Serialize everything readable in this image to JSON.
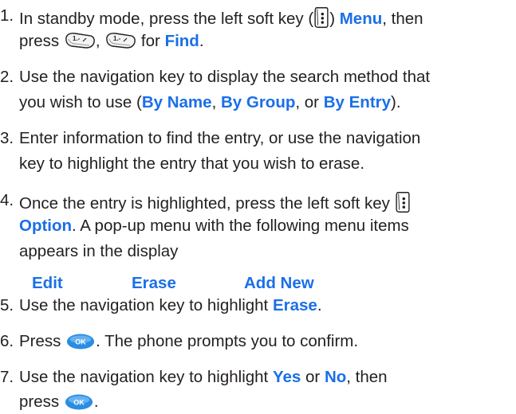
{
  "steps": [
    {
      "num": "1.",
      "l1a": "In standby mode, press the left soft key (",
      "l1b": ") ",
      "l1c": "Menu",
      "l1d": ", then",
      "l2a": "press ",
      "l2b": ", ",
      "l2c": " for ",
      "l2d": "Find",
      "l2e": "."
    },
    {
      "num": "2.",
      "l1": "Use the navigation key to display the search method that",
      "l2a": "you wish to use (",
      "l2b": "By Name",
      "l2c": ", ",
      "l2d": "By Group",
      "l2e": ", or ",
      "l2f": "By Entry",
      "l2g": ")."
    },
    {
      "num": "3.",
      "l1": "Enter information to find the entry, or use the navigation",
      "l2": "key to highlight the entry that you wish to erase."
    },
    {
      "num": "4.",
      "l1": "Once the entry is highlighted, press the left soft key",
      "l2a": "Option",
      "l2b": ". A pop-up menu with the following menu items",
      "l3": "appears in the display"
    },
    {
      "num": "5.",
      "l1a": "Use the navigation key to highlight ",
      "l1b": "Erase",
      "l1c": "."
    },
    {
      "num": "6.",
      "l1a": "Press ",
      "l1b": ". The phone prompts you to confirm."
    },
    {
      "num": "7.",
      "l1a": "Use the navigation key to highlight ",
      "l1b": "Yes",
      "l1c": " or ",
      "l1d": "No",
      "l1e": ", then",
      "l2a": "press ",
      "l2b": "."
    }
  ],
  "menu_options": [
    "Edit",
    "Erase",
    "Add New"
  ],
  "icons": {
    "soft_key": "left-soft-key-icon",
    "key_1": "key-1-icon",
    "ok": "ok-key-icon"
  },
  "colors": {
    "highlight": "#1a6fe8",
    "text": "#231f20"
  }
}
